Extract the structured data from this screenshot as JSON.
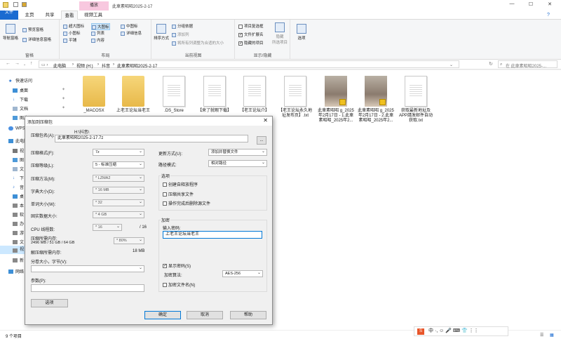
{
  "window": {
    "context_tab": "播放",
    "title": "此車素昭昭2025-2-17"
  },
  "tabs": [
    "文件",
    "主页",
    "共享",
    "查看",
    "视频工具"
  ],
  "ribbon": {
    "panes": {
      "nav_pane": "导航窗格",
      "preview": "预览窗格",
      "details": "详细信息窗格",
      "label": "窗格"
    },
    "layout": {
      "items": [
        "超大图标",
        "大图标",
        "中图标",
        "小图标",
        "列表",
        "详细信息",
        "平铺",
        "内容"
      ],
      "label": "布局"
    },
    "current_view": {
      "sort": "排序方式",
      "group": "分组依据",
      "add_col": "添加列",
      "fit_cols": "将所有列调整为合适的大小",
      "label": "当前视图"
    },
    "show_hide": {
      "item_checkbox": "项目复选框",
      "ext": "文件扩展名",
      "hidden": "隐藏的项目",
      "hide_selected": "隐藏",
      "hide_selected2": "所选项目",
      "label": "显示/隐藏"
    },
    "options": "选项"
  },
  "address": {
    "path": [
      "此电脑",
      "视频 (H:)",
      "抖音",
      "此車素昭昭2025-2-17"
    ],
    "search_placeholder": "在 此車素昭昭2025-..."
  },
  "navpane": [
    "快速访问",
    "桌面",
    "下载",
    "文档",
    "图片",
    "WPS",
    "此电脑",
    "视",
    "图",
    "文",
    "下",
    "音",
    "桌",
    "本",
    "软",
    "办",
    "游",
    "文",
    "视",
    "新",
    "网络"
  ],
  "files": [
    {
      "name": "_MACOSX",
      "type": "folder"
    },
    {
      "name": "上老王论坛当老王",
      "type": "folder"
    },
    {
      "name": ".DS_Store",
      "type": "doc"
    },
    {
      "name": "【来了就暇下载】",
      "type": "doc"
    },
    {
      "name": "【老王论坛介】",
      "type": "doc"
    },
    {
      "name": "【老王论坛永久地址发布页】.txt",
      "type": "doc"
    },
    {
      "name": "此車素昭昭 g_2025年2月17日 - 1.此車素昭昭_2025年2...",
      "type": "photo"
    },
    {
      "name": "此車素昭昭 g_2025年2月17日 - 2.此車素昭昭_2025年2...",
      "type": "photo"
    },
    {
      "name": "获取最新地址及APP請发邮件自动获取.txt",
      "type": "doc"
    }
  ],
  "status": {
    "count": "9 个项目"
  },
  "ime": {
    "logo": "S",
    "text": "中 ·, ☺ 🎤 ⌨ 👕 ⋮⋮"
  },
  "dialog": {
    "title": "添加到压缩包",
    "close": "✕",
    "archive_label": "压缩包名(A):",
    "archive_dir": "H:\\抖音\\",
    "archive_name": "此車素昭昭2025-2-17.7z",
    "browse": "...",
    "format_label": "压缩格式(F):",
    "format": "7z",
    "level_label": "压缩等级(L):",
    "level": "5 - 标准压缩",
    "method_label": "压缩方法(M):",
    "method": "* LZMA2",
    "dict_label": "字典大小(D):",
    "dict": "* 16 MB",
    "word_label": "单词大小(W):",
    "word": "* 32",
    "solid_label": "固实数据大小:",
    "solid": "* 4 GB",
    "cpu_label": "CPU 线程数:",
    "cpu": "* 16",
    "cpu_total": "/ 16",
    "mem_label": "压缩所需内存:",
    "mem_detail": "2496 MB / 51 GB / 64 GB",
    "mem_pct": "* 80%",
    "decomp_label": "解压缩所需内存:",
    "decomp_value": "18 MB",
    "split_label": "分卷大小，字节(V):",
    "split_value": "",
    "params_label": "参数(P):",
    "params_value": "",
    "options_btn": "选项",
    "update_label": "更新方式(U):",
    "update": "添加并替换文件",
    "pathmode_label": "路径模式:",
    "pathmode": "相对路径",
    "opt_group": "选项",
    "opt_sfx": "创建自释放程序",
    "opt_shared": "压缩共享文件",
    "opt_delete": "操作完成后删除源文件",
    "enc_group": "加密",
    "pwd_label": "输入密码:",
    "pwd_value": "上老王论坛当老王",
    "show_pwd": "显示密码(S)",
    "enc_method_label": "加密算法:",
    "enc_method": "AES-256",
    "enc_names": "加密文件名(N)",
    "ok": "确定",
    "cancel": "取消",
    "help": "帮助"
  }
}
